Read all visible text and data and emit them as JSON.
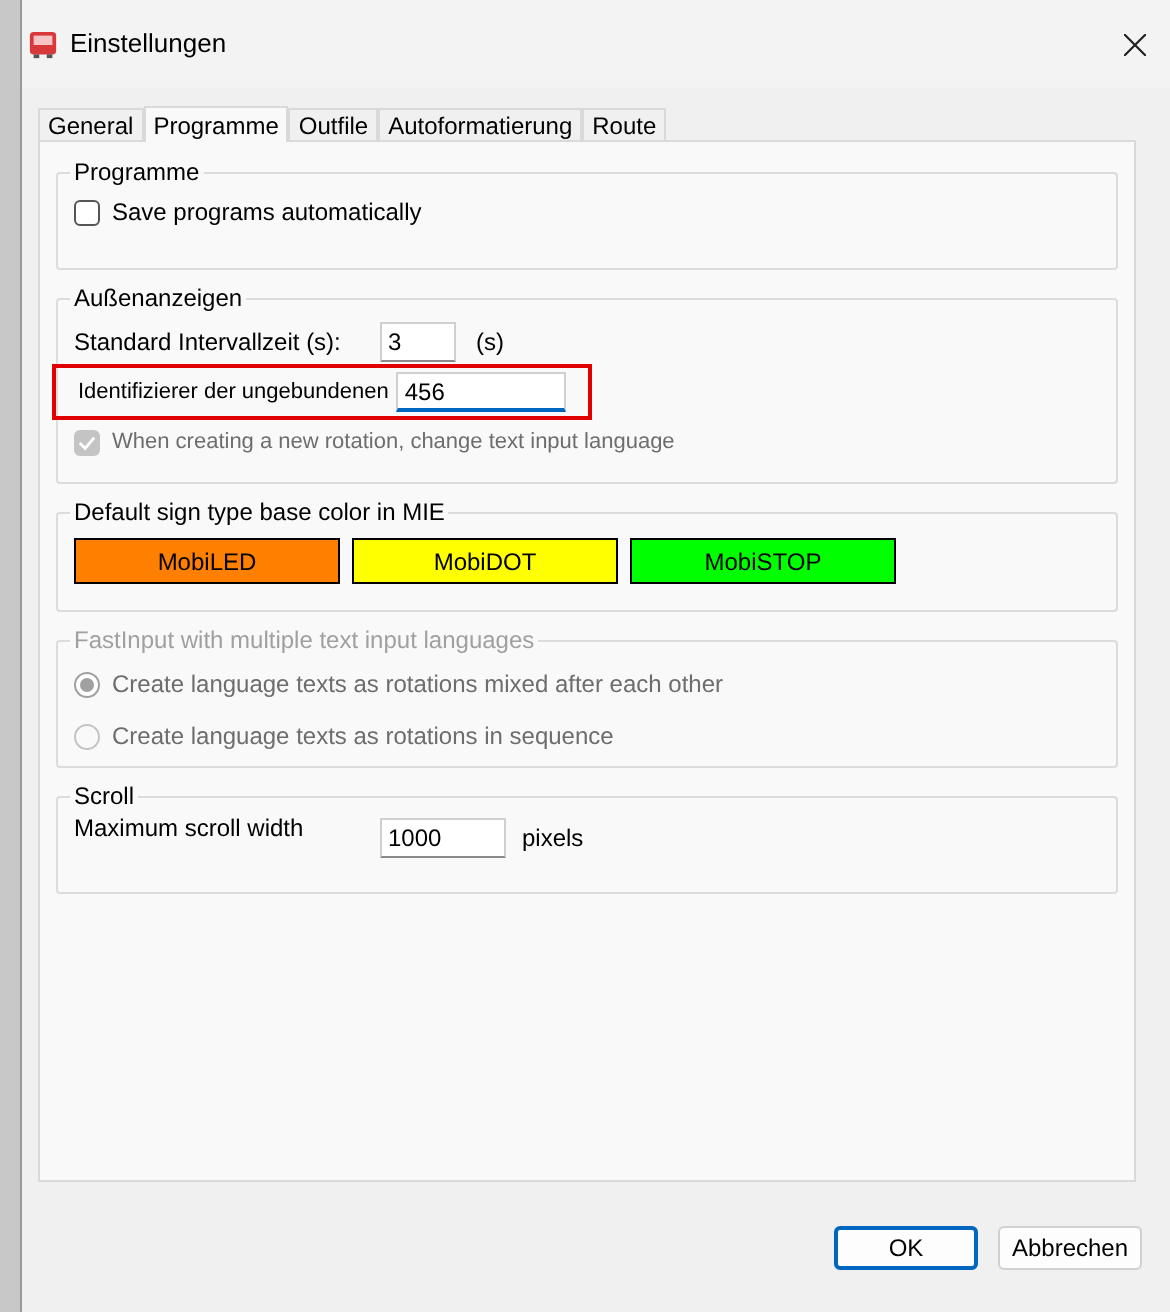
{
  "window": {
    "title": "Einstellungen"
  },
  "tabs": [
    {
      "label": "General",
      "selected": false
    },
    {
      "label": "Programme",
      "selected": true
    },
    {
      "label": "Outfile",
      "selected": false
    },
    {
      "label": "Autoformatierung",
      "selected": false
    },
    {
      "label": "Route",
      "selected": false
    }
  ],
  "programme": {
    "title": "Programme",
    "checkbox": {
      "label": "Save programs automatically",
      "checked": false
    }
  },
  "aussenanzeigen": {
    "title": "Außenanzeigen",
    "interval": {
      "label": "Standard Intervallzeit (s):",
      "value": "3",
      "unit": "(s)"
    },
    "identifier": {
      "label": "Identifizierer der ungebundenen",
      "value": "456",
      "highlighted": true,
      "focused": true
    },
    "rotation": {
      "label": "When creating a new rotation, change text input language",
      "checked": true,
      "disabled": true
    }
  },
  "sign_colors": {
    "title": "Default sign type base color in MIE",
    "buttons": [
      {
        "label": "MobiLED",
        "color": "#ff8000"
      },
      {
        "label": "MobiDOT",
        "color": "#ffff00"
      },
      {
        "label": "MobiSTOP",
        "color": "#00ff00"
      }
    ]
  },
  "fastinput": {
    "title": "FastInput with multiple text input languages",
    "disabled": true,
    "options": [
      {
        "label": "Create language texts as rotations mixed after each other",
        "selected": true
      },
      {
        "label": "Create language texts as rotations in sequence",
        "selected": false
      }
    ]
  },
  "scroll": {
    "title": "Scroll",
    "label": "Maximum scroll width",
    "value": "1000",
    "unit": "pixels"
  },
  "buttons": [
    {
      "label": "OK",
      "default": true
    },
    {
      "label": "Abbrechen",
      "default": false
    }
  ]
}
